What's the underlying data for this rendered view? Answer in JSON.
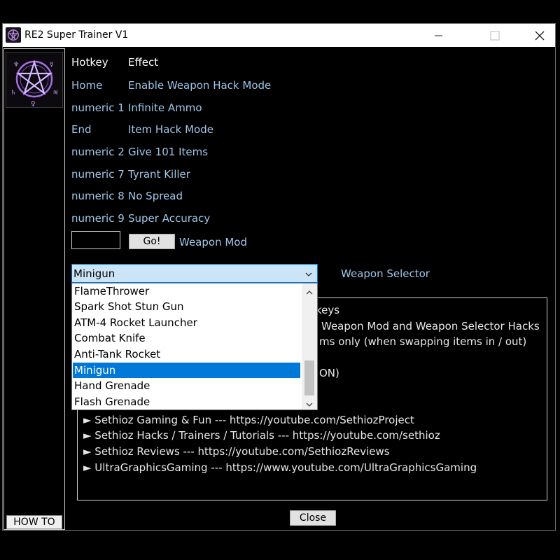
{
  "window": {
    "title": "RE2 Super Trainer V1"
  },
  "sidebar": {
    "howto_label": "HOW TO"
  },
  "hotkeys": {
    "header": {
      "hotkey": "Hotkey",
      "effect": "Effect"
    },
    "rows": [
      {
        "key": "Home",
        "effect": "Enable Weapon Hack Mode"
      },
      {
        "key": "numeric 1",
        "effect": "Infinite Ammo"
      },
      {
        "key": "End",
        "effect": "Item Hack Mode"
      },
      {
        "key": "numeric 2",
        "effect": "Give 101 Items"
      },
      {
        "key": "numeric 7",
        "effect": "Tyrant Killer"
      },
      {
        "key": "numeric 8",
        "effect": "No Spread"
      },
      {
        "key": "numeric 9",
        "effect": "Super Accuracy"
      }
    ]
  },
  "weapon_mod": {
    "input_value": "",
    "go_label": "Go!",
    "label": "Weapon Mod"
  },
  "weapon_selector": {
    "selected": "Minigun",
    "label": "Weapon Selector",
    "options": [
      "FlameThrower",
      "Spark Shot Stun Gun",
      "ATM-4 Rocket Launcher",
      "Combat Knife",
      "Anti-Tank Rocket",
      "Minigun",
      "Hand Grenade",
      "Flash Grenade"
    ]
  },
  "info": {
    "lines_partial": [
      "keys",
      "Weapon Mod and Weapon Selector Hacks",
      "ms only (when swapping items in / out)",
      "ON)"
    ],
    "links": [
      "► Sethioz Gaming & Fun --- https://youtube.com/SethiozProject",
      "► Sethioz Hacks / Trainers / Tutorials --- https://youtube.com/sethioz",
      "► Sethioz Reviews --- https://youtube.com/SethiozReviews",
      "► UltraGraphicsGaming --- https://www.youtube.com/UltraGraphicsGaming"
    ]
  },
  "footer": {
    "close_label": "Close"
  }
}
